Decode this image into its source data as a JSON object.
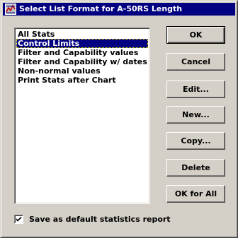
{
  "window": {
    "title": "Select List Format for A-50RS Length",
    "icon": "app-chart-icon",
    "titlebar_color": "#000080"
  },
  "list": {
    "items": [
      {
        "label": "All Stats",
        "selected": false
      },
      {
        "label": "Control Limits",
        "selected": true
      },
      {
        "label": "Filter and Capability values",
        "selected": false
      },
      {
        "label": "Filter and Capability w/ dates",
        "selected": false
      },
      {
        "label": "Non-normal values",
        "selected": false
      },
      {
        "label": "Print Stats after Chart",
        "selected": false
      }
    ]
  },
  "buttons": {
    "ok": "OK",
    "cancel": "Cancel",
    "edit": "Edit...",
    "new": "New...",
    "copy": "Copy...",
    "delete": "Delete",
    "ok_for_all": "OK for All"
  },
  "options": {
    "save_default_label": "Save as default statistics report",
    "save_default_checked": true
  }
}
